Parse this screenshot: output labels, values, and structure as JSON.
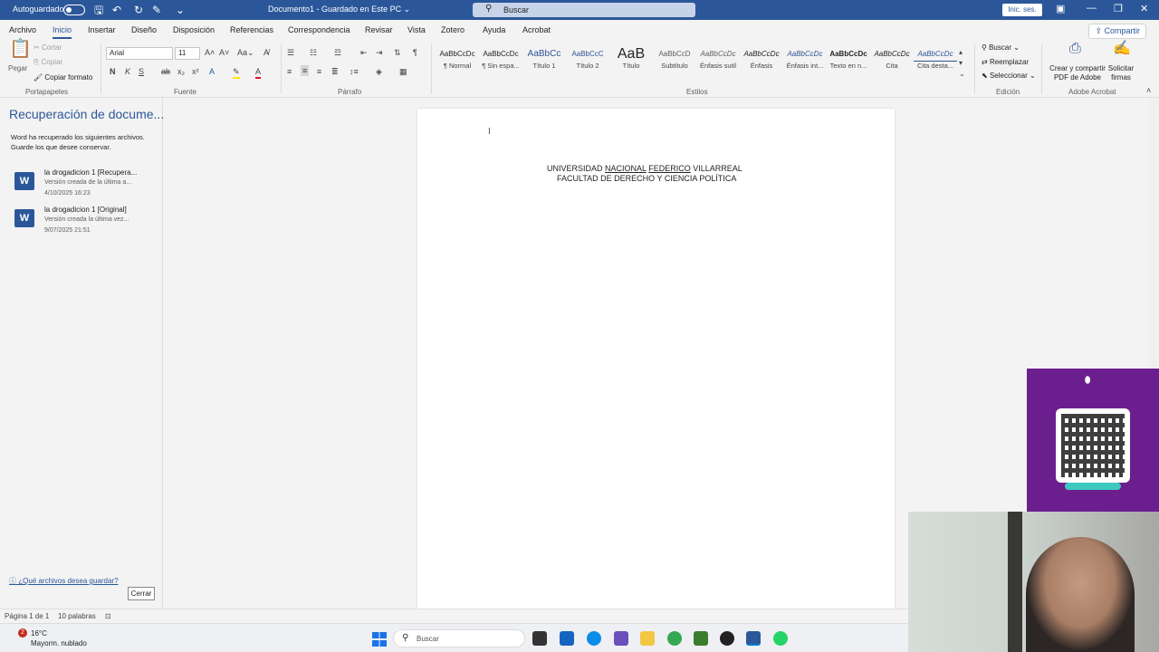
{
  "titlebar": {
    "autosave_label": "Autoguardado",
    "doc_title": "Documento1 - Guardado en Este PC ⌄",
    "search_placeholder": "Buscar",
    "signin_label": "Inic. ses."
  },
  "menu": {
    "tabs": [
      "Archivo",
      "Inicio",
      "Insertar",
      "Diseño",
      "Disposición",
      "Referencias",
      "Correspondencia",
      "Revisar",
      "Vista",
      "Zotero",
      "Ayuda",
      "Acrobat"
    ],
    "share_label": "Compartir"
  },
  "ribbon": {
    "clipboard": {
      "paste": "Pegar",
      "cut": "Cortar",
      "copy": "Copiar",
      "format_painter": "Copiar formato",
      "group_label": "Portapapeles"
    },
    "font": {
      "name": "Arial",
      "size": "11",
      "group_label": "Fuente"
    },
    "paragraph": {
      "group_label": "Párrafo"
    },
    "styles": {
      "group_label": "Estilos",
      "items": [
        {
          "sample": "AaBbCcDc",
          "name": "¶ Normal"
        },
        {
          "sample": "AaBbCcDc",
          "name": "¶ Sin espa..."
        },
        {
          "sample": "AaBbCc",
          "name": "Título 1"
        },
        {
          "sample": "AaBbCcC",
          "name": "Título 2"
        },
        {
          "sample": "AaB",
          "name": "Título"
        },
        {
          "sample": "AaBbCcD",
          "name": "Subtítulo"
        },
        {
          "sample": "AaBbCcDc",
          "name": "Énfasis sutil"
        },
        {
          "sample": "AaBbCcDc",
          "name": "Énfasis"
        },
        {
          "sample": "AaBbCcDc",
          "name": "Énfasis int..."
        },
        {
          "sample": "AaBbCcDc",
          "name": "Texto en n..."
        },
        {
          "sample": "AaBbCcDc",
          "name": "Cita"
        },
        {
          "sample": "AaBbCcDc",
          "name": "Cita desta..."
        }
      ]
    },
    "editing": {
      "find": "Buscar",
      "replace": "Reemplazar",
      "select": "Seleccionar",
      "group_label": "Edición"
    },
    "acrobat": {
      "create_share": "Crear y compartir PDF de Adobe",
      "request_sign": "Solicitar firmas",
      "group_label": "Adobe Acrobat"
    }
  },
  "recovery": {
    "title": "Recuperación de docume...",
    "description": "Word ha recuperado los siguientes archivos. Guarde los que desee conservar.",
    "files": [
      {
        "name": "la drogadicion 1 [Recupera...",
        "version": "Versión creada de la última a...",
        "date": "4/10/2025 16:23"
      },
      {
        "name": "la drogadicion 1 [Original]",
        "version": "Versión creada la última vez...",
        "date": "9/07/2025 21:51"
      }
    ],
    "help_link": "¿Qué archivos desea guardar?",
    "close_label": "Cerrar"
  },
  "document": {
    "line1_a": "UNIVERSIDAD ",
    "line1_b": "NACIONAL",
    "line1_c": "  ",
    "line1_d": "FEDERICO",
    "line1_e": " VILLARREAL",
    "line2": "FACULTAD DE DERECHO Y CIENCIA POLÍTICA"
  },
  "statusbar": {
    "page": "Página 1 de 1",
    "words": "10 palabras"
  },
  "taskbar": {
    "weather_badge": "2",
    "temperature": "16°C",
    "condition": "Mayorm. nublado",
    "search_placeholder": "Buscar"
  },
  "colors": {
    "word_blue": "#2b579a",
    "promo_purple": "#6b1f8f"
  }
}
